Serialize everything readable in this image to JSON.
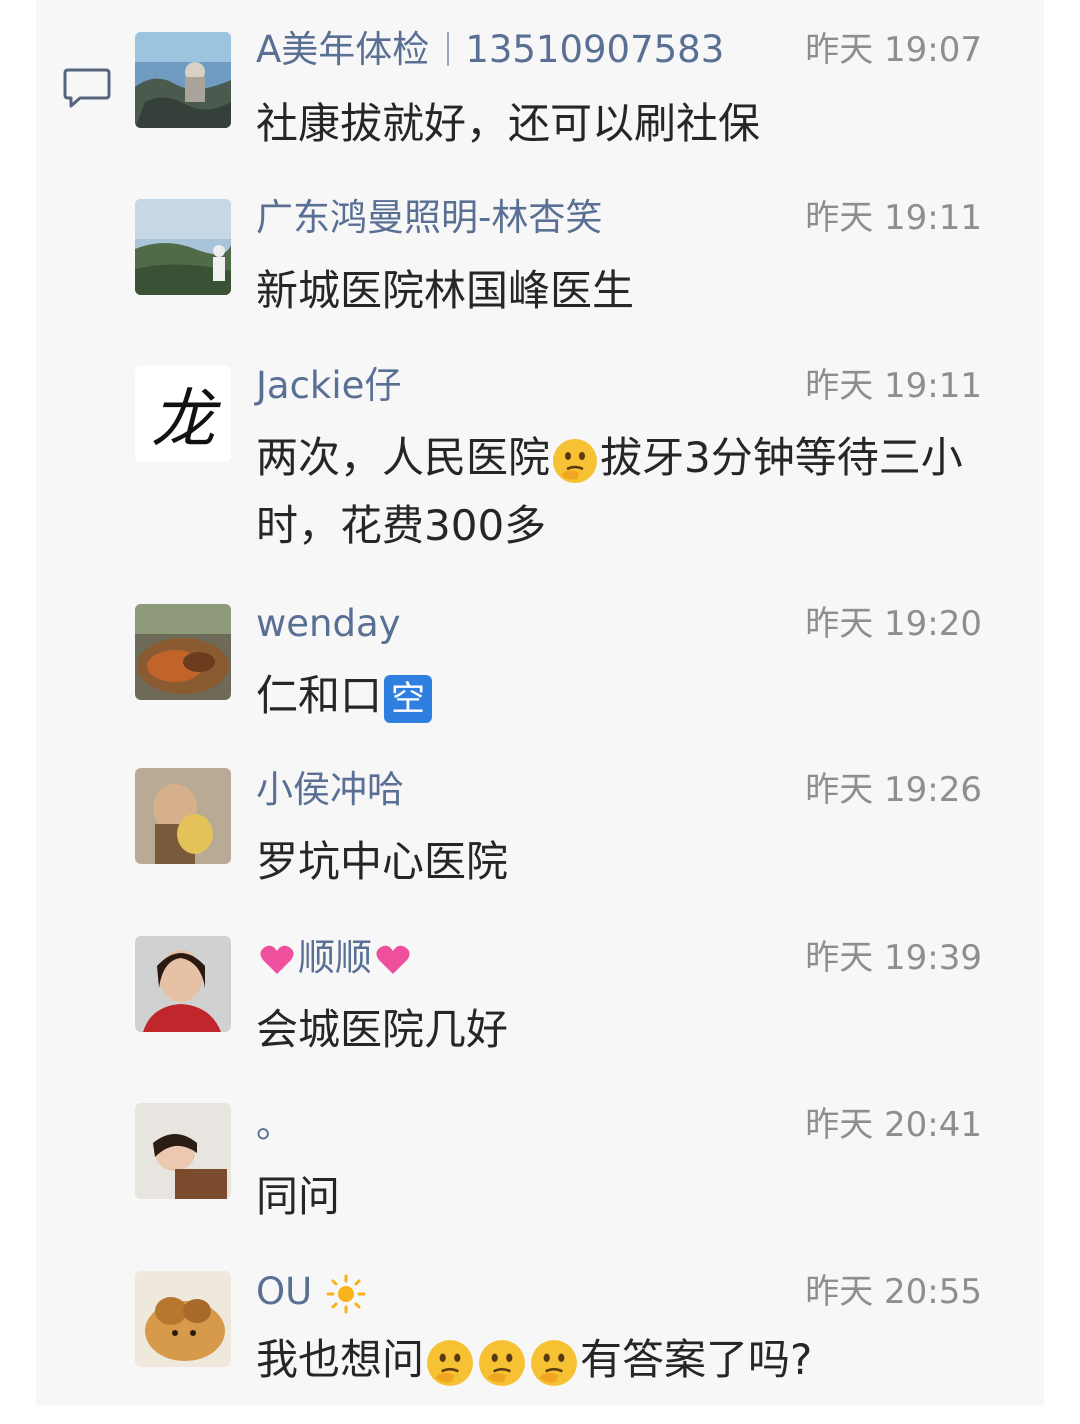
{
  "messages": [
    {
      "name_pre": "A美年体检",
      "name_post": "13510907583",
      "time": "昨天 19:07",
      "text": "社康拔就好，还可以刷社保"
    },
    {
      "name": "广东鸿曼照明-林杏笑",
      "time": "昨天 19:11",
      "text": "新城医院林国峰医生"
    },
    {
      "name": "Jackie仔",
      "avatar_char": "龙",
      "time": "昨天 19:11",
      "text_a": "两次，人民医院",
      "text_b": "拔牙3分钟等待三小时，花费300多"
    },
    {
      "name": "wenday",
      "time": "昨天 19:20",
      "text": "仁和口",
      "badge": "空"
    },
    {
      "name": "小侯冲哈",
      "time": "昨天 19:26",
      "text": "罗坑中心医院"
    },
    {
      "name": "顺顺",
      "time": "昨天 19:39",
      "text": "会城医院几好"
    },
    {
      "name": "。",
      "time": "昨天 20:41",
      "text": "同问"
    },
    {
      "name": "OU",
      "time": "昨天 20:55",
      "text_a": "我也想问",
      "text_b": "有答案了吗?"
    }
  ],
  "icons": {
    "comment": "comment-bubble-icon",
    "thinking": "thinking-face-emoji",
    "heart": "heart-emoji",
    "sun": "sun-emoji"
  },
  "colors": {
    "name": "#5a6f94",
    "time": "#8e8e8e",
    "text": "#262626",
    "panel": "#f7f7f7"
  }
}
